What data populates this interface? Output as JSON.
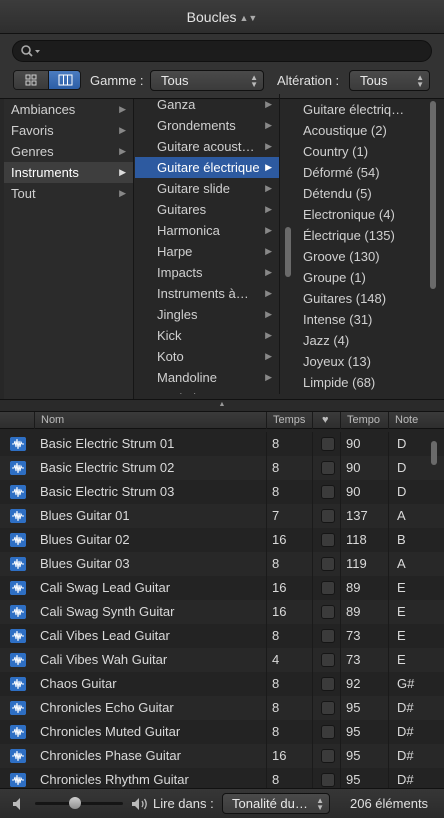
{
  "window": {
    "title": "Boucles"
  },
  "filters": {
    "gamme_label": "Gamme :",
    "gamme_value": "Tous",
    "alteration_label": "Altération :",
    "alteration_value": "Tous"
  },
  "browser": {
    "col1": [
      {
        "label": "Ambiances"
      },
      {
        "label": "Favoris"
      },
      {
        "label": "Genres"
      },
      {
        "label": "Instruments",
        "selected": true
      },
      {
        "label": "Tout"
      }
    ],
    "col2": [
      {
        "label": "Ganza"
      },
      {
        "label": "Grondements"
      },
      {
        "label": "Guitare acoust…"
      },
      {
        "label": "Guitare électrique",
        "highlighted": true
      },
      {
        "label": "Guitare slide"
      },
      {
        "label": "Guitares"
      },
      {
        "label": "Harmonica"
      },
      {
        "label": "Harpe"
      },
      {
        "label": "Impacts"
      },
      {
        "label": "Instruments à…"
      },
      {
        "label": "Jingles"
      },
      {
        "label": "Kick"
      },
      {
        "label": "Koto"
      },
      {
        "label": "Mandoline"
      },
      {
        "label": "Marimba"
      }
    ],
    "col3": [
      {
        "label": "Guitare électriq…"
      },
      {
        "label": "Acoustique (2)"
      },
      {
        "label": "Country (1)"
      },
      {
        "label": "Déformé (54)"
      },
      {
        "label": "Détendu (5)"
      },
      {
        "label": "Electronique (4)"
      },
      {
        "label": "Électrique (135)"
      },
      {
        "label": "Groove (130)"
      },
      {
        "label": "Groupe (1)"
      },
      {
        "label": "Guitares (148)"
      },
      {
        "label": "Intense (31)"
      },
      {
        "label": "Jazz (4)"
      },
      {
        "label": "Joyeux (13)"
      },
      {
        "label": "Limpide (68)"
      }
    ]
  },
  "table": {
    "headers": {
      "name": "Nom",
      "beats": "Temps",
      "fav": "♥",
      "tempo": "Tempo",
      "key": "Note"
    },
    "rows": [
      {
        "name": "Basic Electric Strum 01",
        "beats": "8",
        "tempo": "90",
        "key": "D"
      },
      {
        "name": "Basic Electric Strum 02",
        "beats": "8",
        "tempo": "90",
        "key": "D"
      },
      {
        "name": "Basic Electric Strum 03",
        "beats": "8",
        "tempo": "90",
        "key": "D"
      },
      {
        "name": "Blues Guitar 01",
        "beats": "7",
        "tempo": "137",
        "key": "A"
      },
      {
        "name": "Blues Guitar 02",
        "beats": "16",
        "tempo": "118",
        "key": "B"
      },
      {
        "name": "Blues Guitar 03",
        "beats": "8",
        "tempo": "119",
        "key": "A"
      },
      {
        "name": "Cali Swag Lead Guitar",
        "beats": "16",
        "tempo": "89",
        "key": "E"
      },
      {
        "name": "Cali Swag Synth Guitar",
        "beats": "16",
        "tempo": "89",
        "key": "E"
      },
      {
        "name": "Cali Vibes Lead Guitar",
        "beats": "8",
        "tempo": "73",
        "key": "E"
      },
      {
        "name": "Cali Vibes Wah Guitar",
        "beats": "4",
        "tempo": "73",
        "key": "E"
      },
      {
        "name": "Chaos Guitar",
        "beats": "8",
        "tempo": "92",
        "key": "G#"
      },
      {
        "name": "Chronicles Echo Guitar",
        "beats": "8",
        "tempo": "95",
        "key": "D#"
      },
      {
        "name": "Chronicles Muted Guitar",
        "beats": "8",
        "tempo": "95",
        "key": "D#"
      },
      {
        "name": "Chronicles Phase Guitar",
        "beats": "16",
        "tempo": "95",
        "key": "D#"
      },
      {
        "name": "Chronicles Rhythm Guitar",
        "beats": "8",
        "tempo": "95",
        "key": "D#"
      }
    ]
  },
  "footer": {
    "play_in_label": "Lire dans :",
    "play_in_value": "Tonalité du…",
    "count": "206 éléments",
    "volume_level": 0.45
  }
}
